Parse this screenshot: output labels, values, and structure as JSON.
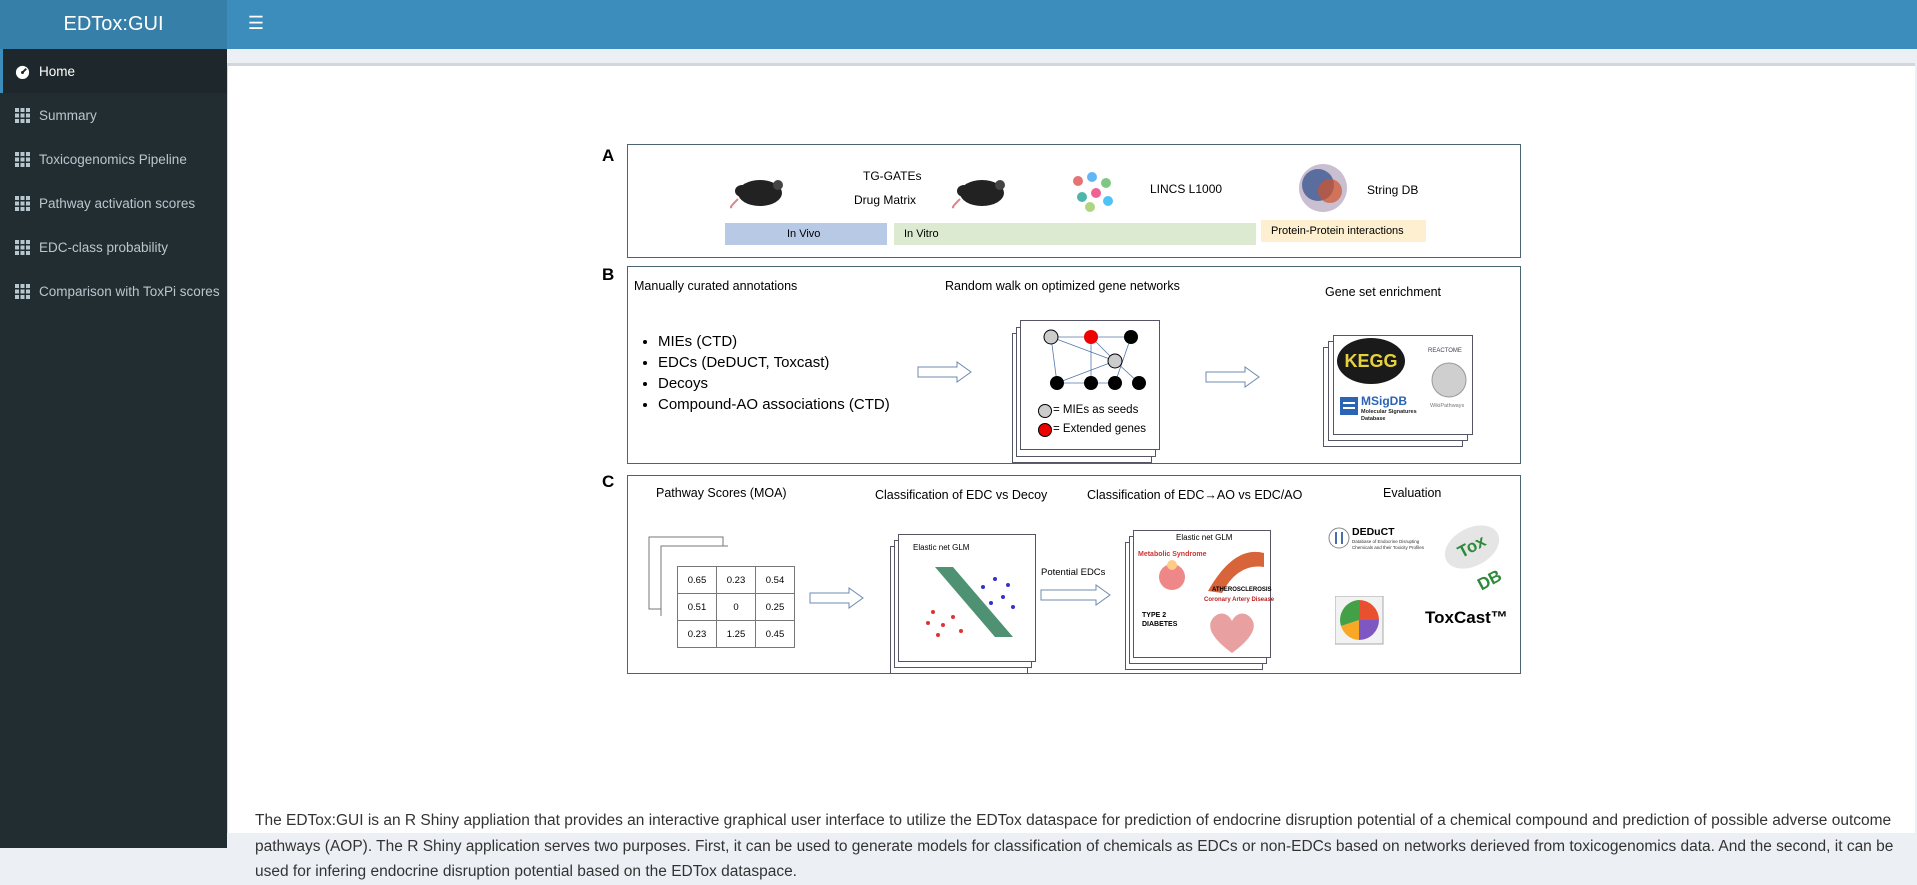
{
  "app": {
    "title": "EDTox:GUI"
  },
  "header": {
    "toggle_icon": "hamburger-icon"
  },
  "sidebar": {
    "items": [
      {
        "label": "Home",
        "icon": "dashboard-icon",
        "active": true
      },
      {
        "label": "Summary",
        "icon": "grid-icon"
      },
      {
        "label": "Toxicogenomics Pipeline",
        "icon": "grid-icon"
      },
      {
        "label": "Pathway activation scores",
        "icon": "grid-icon"
      },
      {
        "label": "EDC-class probability",
        "icon": "grid-icon"
      },
      {
        "label": "Comparison with ToxPi scores",
        "icon": "grid-icon"
      }
    ]
  },
  "figure": {
    "panel_a": {
      "letter": "A",
      "tg_gates": "TG-GATEs",
      "drug_matrix": "Drug Matrix",
      "lincs": "LINCS L1000",
      "string_db": "String DB",
      "in_vivo": "In Vivo",
      "in_vitro": "In Vitro",
      "ppi": "Protein-Protein interactions"
    },
    "panel_b": {
      "letter": "B",
      "annotations_title": "Manually curated annotations",
      "annotations": [
        "MIEs (CTD)",
        "EDCs (DeDUCT, Toxcast)",
        "Decoys",
        "Compound-AO associations (CTD)"
      ],
      "random_walk_title": "Random walk on optimized gene networks",
      "legend_seeds": "= MIEs as seeds",
      "legend_extended": "= Extended genes",
      "enrichment_title": "Gene set enrichment",
      "kegg": "KEGG",
      "reactome": "REACTOME",
      "msigdb": "MSigDB",
      "msigdb_sub": "Molecular Signatures Database",
      "wikipathways": "WikiPathways"
    },
    "panel_c": {
      "letter": "C",
      "pathway_scores_title": "Pathway Scores (MOA)",
      "score_rows": [
        [
          "0.65",
          "0.23",
          "0.54"
        ],
        [
          "0.51",
          "0",
          "0.25"
        ],
        [
          "0.23",
          "1.25",
          "0.45"
        ]
      ],
      "classification_title": "Classification of EDC vs Decoy",
      "elastic_net": "Elastic net GLM",
      "potential_edcs": "Potential EDCs",
      "classification_ao_title": "Classification of EDC→AO  vs EDC/AO",
      "elastic_net_2": "Elastic net GLM",
      "metabolic": "Metabolic Syndrome",
      "atherosclerosis": "ATHEROSCLEROSIS",
      "coronary": "Coronary Artery Disease",
      "diabetes": "TYPE 2 DIABETES",
      "evaluation_title": "Evaluation",
      "deduct": "DEDuCT",
      "deduct_sub": "Database of Endocrine Disrupting Chemicals and their Toxicity Profiles",
      "toxdb": "Tox DB",
      "toxcast": "ToxCast™"
    }
  },
  "description": "The EDTox:GUI is an R Shiny appliation that provides an interactive graphical user interface to utilize the EDTox dataspace for prediction of endocrine disruption potential of a chemical compound and prediction of possible adverse outcome pathways (AOP). The R Shiny application serves two purposes. First, it can be used to generate models for classification of chemicals as EDCs or non-EDCs based on networks derieved from toxicogenomics data. And the second, it can be used for infering endocrine disruption potential based on the EDTox dataspace.",
  "colors": {
    "header": "#3c8dbc",
    "logo": "#367fa9",
    "sidebar": "#222d32"
  }
}
